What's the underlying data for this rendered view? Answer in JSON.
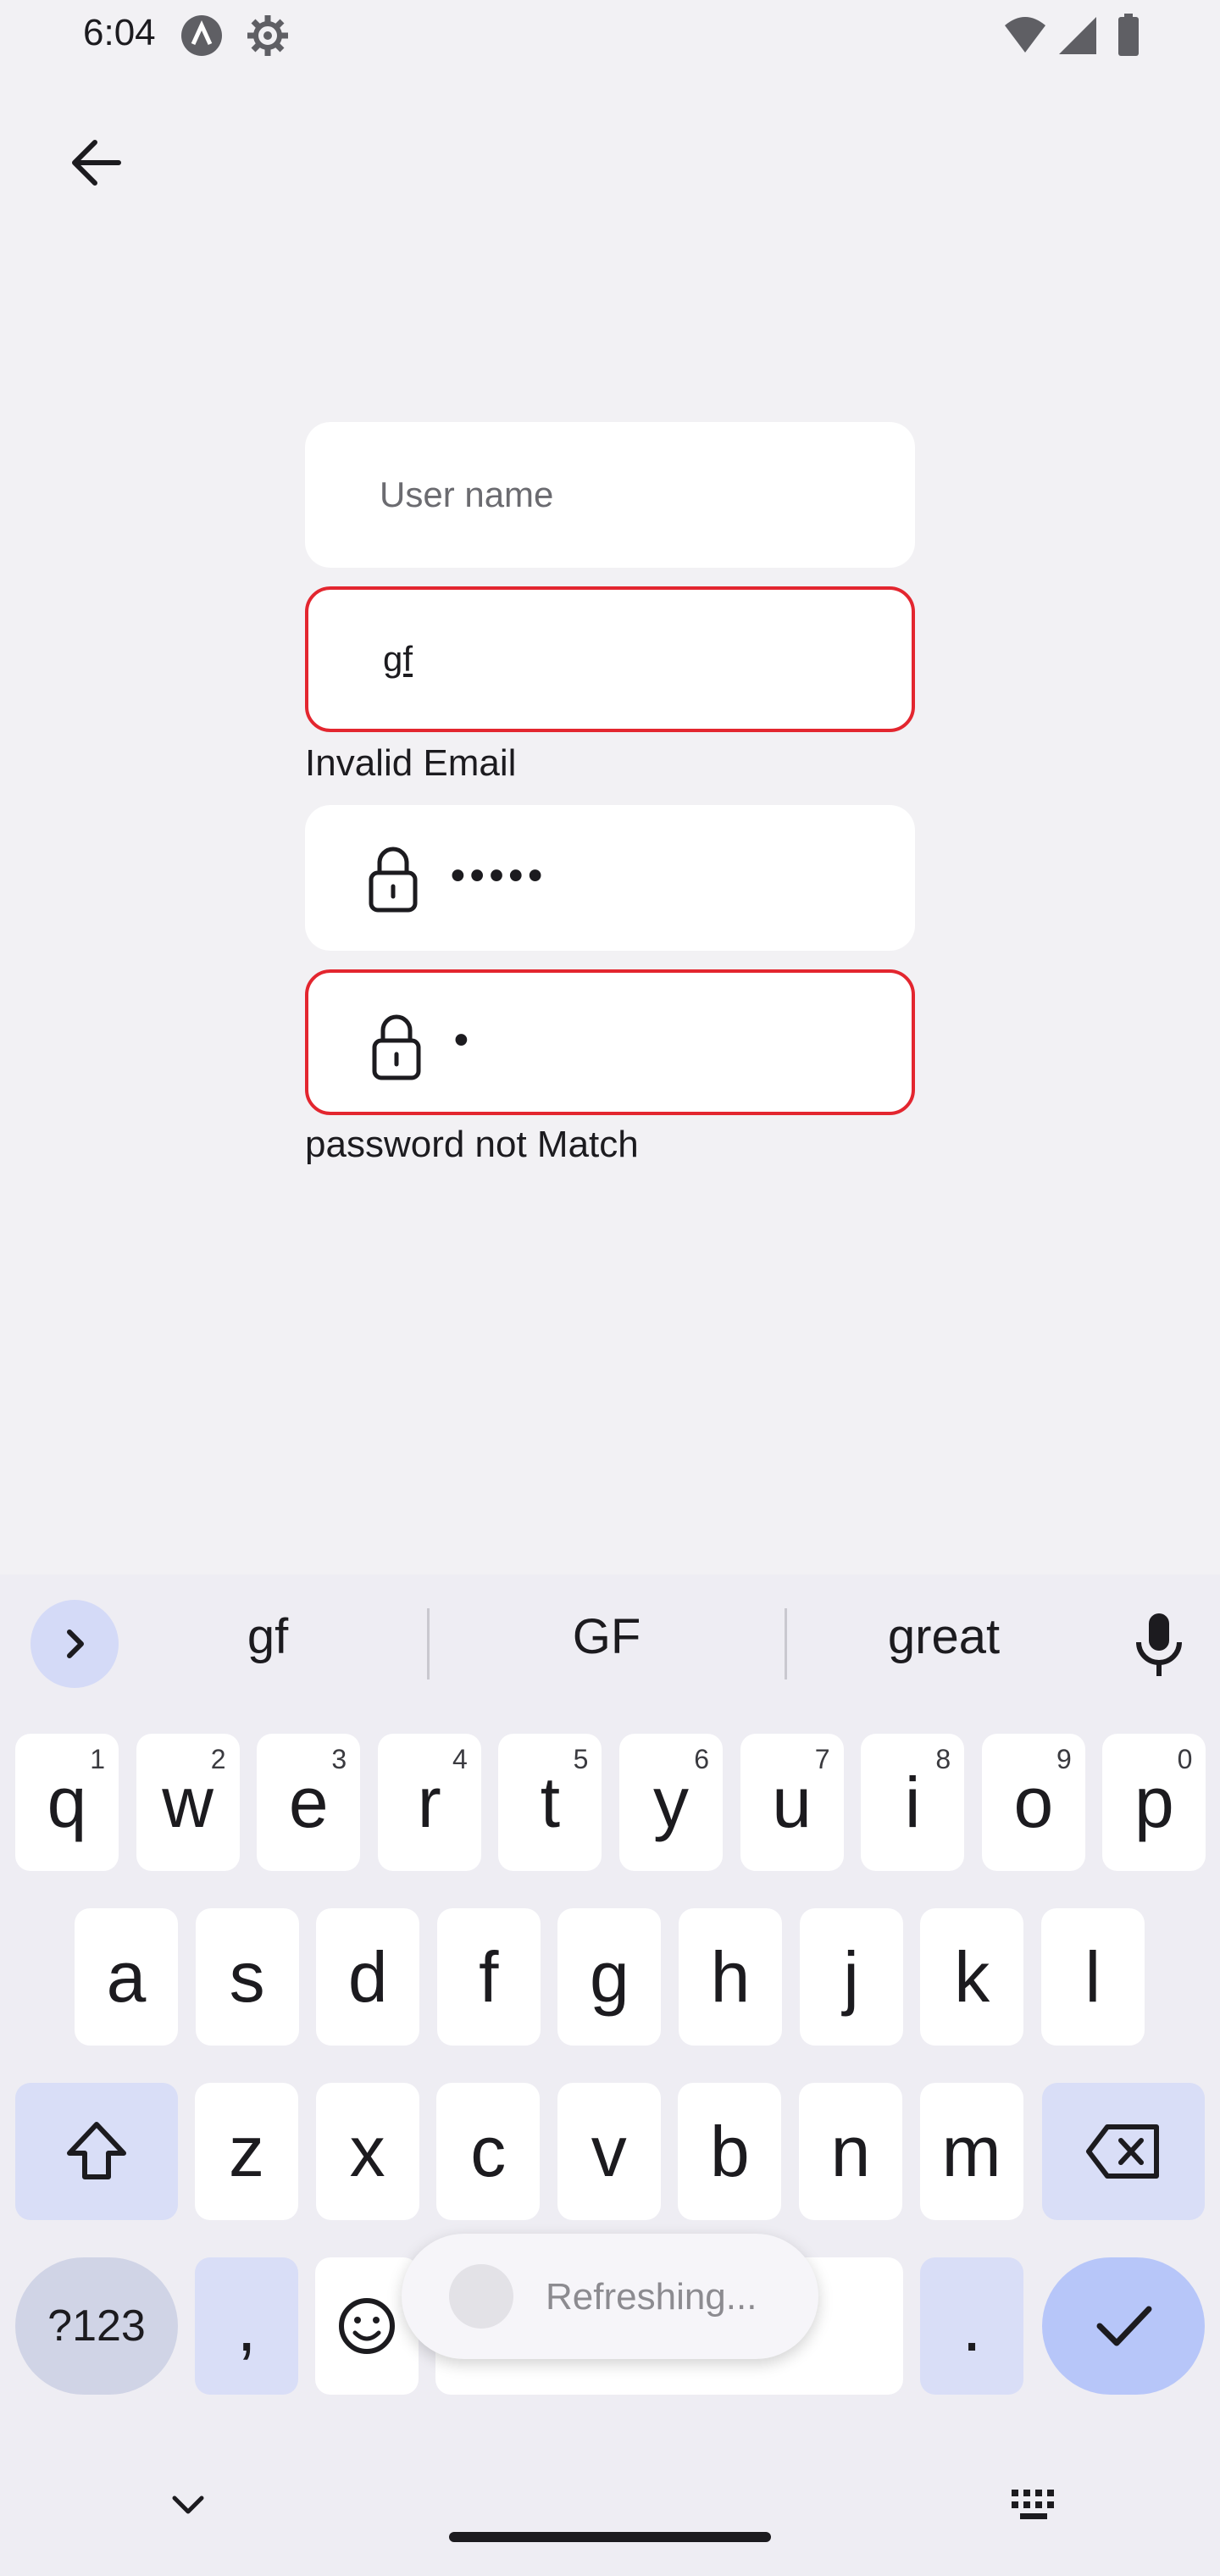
{
  "status_bar": {
    "time": "6:04"
  },
  "form": {
    "username_placeholder": "User name",
    "email_value": "gf",
    "email_error": "Invalid Email",
    "password_value": "•••••",
    "confirm_value": "•",
    "confirm_error": "password not Match"
  },
  "keyboard": {
    "suggestions": [
      "gf",
      "GF",
      "great"
    ],
    "row1": [
      {
        "k": "q",
        "h": "1"
      },
      {
        "k": "w",
        "h": "2"
      },
      {
        "k": "e",
        "h": "3"
      },
      {
        "k": "r",
        "h": "4"
      },
      {
        "k": "t",
        "h": "5"
      },
      {
        "k": "y",
        "h": "6"
      },
      {
        "k": "u",
        "h": "7"
      },
      {
        "k": "i",
        "h": "8"
      },
      {
        "k": "o",
        "h": "9"
      },
      {
        "k": "p",
        "h": "0"
      }
    ],
    "row2": [
      "a",
      "s",
      "d",
      "f",
      "g",
      "h",
      "j",
      "k",
      "l"
    ],
    "row3": [
      "z",
      "x",
      "c",
      "v",
      "b",
      "n",
      "m"
    ],
    "symbols_label": "?123",
    "comma": ",",
    "period": "."
  },
  "toast": {
    "text": "Refreshing..."
  },
  "colors": {
    "error": "#e3262f",
    "accent": "#b7c6f9",
    "special_key": "#d9def7"
  }
}
